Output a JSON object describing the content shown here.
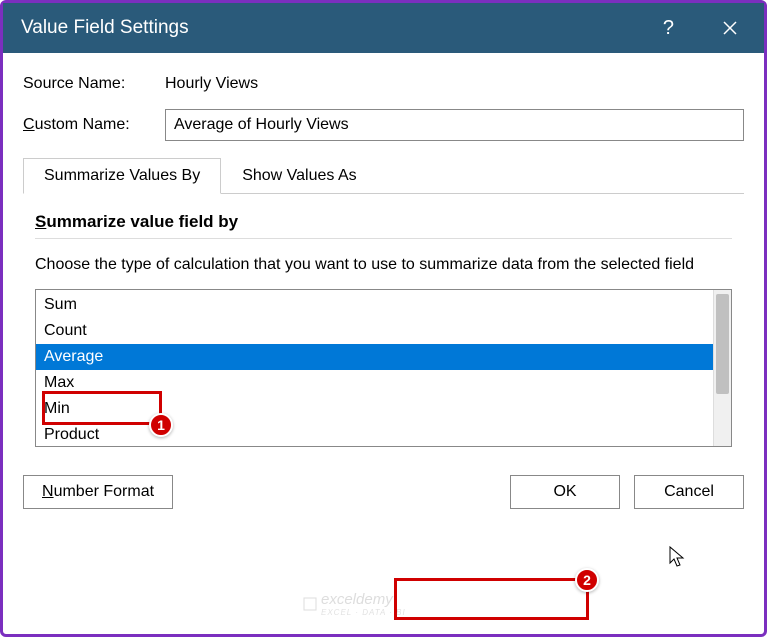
{
  "titlebar": {
    "title": "Value Field Settings",
    "help": "?",
    "close": "✕"
  },
  "source": {
    "label_prefix": "Source Name:",
    "value": "Hourly Views"
  },
  "custom": {
    "label_text": "ustom Name:",
    "label_underlined": "C",
    "value": "Average of Hourly Views"
  },
  "tabs": {
    "summarize": "Summarize Values By",
    "show": "Show Values As"
  },
  "section": {
    "heading_underlined": "S",
    "heading_text": "ummarize value field by",
    "instruction": "Choose the type of calculation that you want to use to summarize data from the selected field"
  },
  "calc_list": {
    "items": [
      "Sum",
      "Count",
      "Average",
      "Max",
      "Min",
      "Product"
    ],
    "selected_index": 2
  },
  "buttons": {
    "number_format_underlined": "N",
    "number_format_text": "umber Format",
    "ok": "OK",
    "cancel": "Cancel"
  },
  "annotations": {
    "badge1": "1",
    "badge2": "2"
  },
  "watermark": {
    "text": "exceldemy",
    "sub": "EXCEL · DATA · BI"
  }
}
